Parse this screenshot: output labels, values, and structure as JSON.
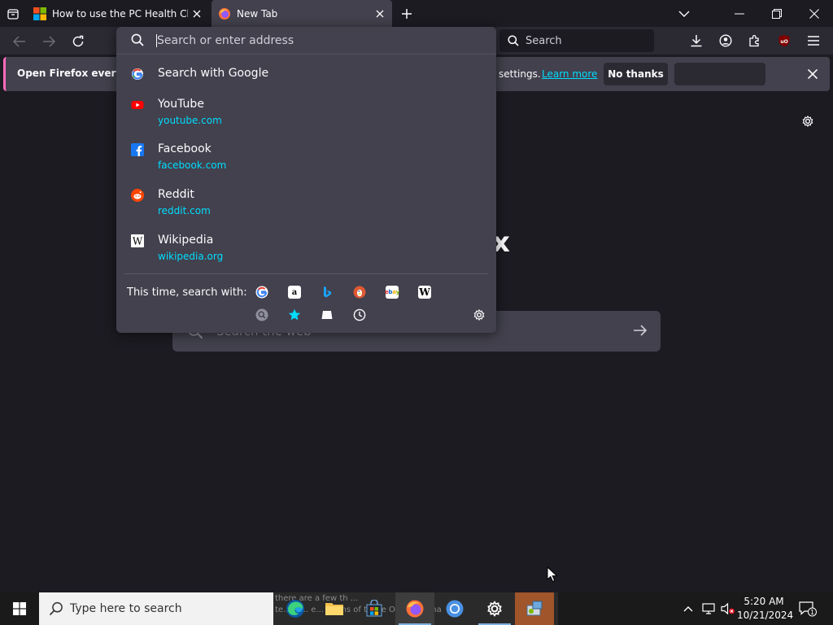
{
  "tabs": [
    {
      "title": "How to use the PC Health Check",
      "favicon": "microsoft-logo-icon",
      "active": false
    },
    {
      "title": "New Tab",
      "favicon": "firefox-logo-icon",
      "active": true
    }
  ],
  "toolbar": {
    "search_placeholder": "Search"
  },
  "notification": {
    "text": "Open Firefox every ti",
    "tail": "settings.",
    "link": "Learn more",
    "no_thanks": "No thanks"
  },
  "urlbar": {
    "placeholder": "Search or enter address",
    "results": [
      {
        "title": "Search with Google",
        "url": "",
        "icon": "google-icon"
      },
      {
        "title": "YouTube",
        "url": "youtube.com",
        "icon": "youtube-icon"
      },
      {
        "title": "Facebook",
        "url": "facebook.com",
        "icon": "facebook-icon"
      },
      {
        "title": "Reddit",
        "url": "reddit.com",
        "icon": "reddit-icon"
      },
      {
        "title": "Wikipedia",
        "url": "wikipedia.org",
        "icon": "wikipedia-icon"
      }
    ],
    "one_off_label": "This time, search with:",
    "engines": [
      "google",
      "amazon",
      "bing",
      "duckduckgo",
      "ebay",
      "wikipedia",
      "search-history",
      "bookmarks",
      "tabs",
      "history"
    ]
  },
  "newtab": {
    "logo_fragment": "x",
    "search_placeholder": "Search the web"
  },
  "taskbar": {
    "search_placeholder": "Type here to search",
    "ghost_text_1": "there are a few th ...",
    "ghost_text_2": "te... W... e... ...ions of these OSes that ha",
    "time": "5:20 AM",
    "date": "10/21/2024",
    "notification_count": "1"
  },
  "colors": {
    "accent": "#00ddff",
    "chrome_bg": "#1c1b22",
    "toolbar_bg": "#2b2a33",
    "panel_bg": "#42414d",
    "notification_accent": "#ff6bba"
  }
}
